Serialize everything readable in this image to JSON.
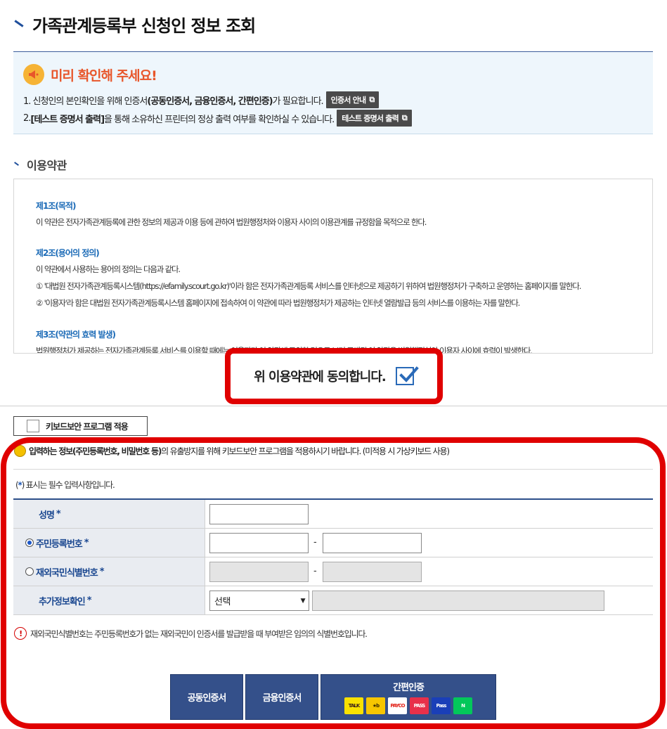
{
  "page": {
    "title": "가족관계등록부 신청인 정보 조회"
  },
  "notice": {
    "heading": "미리 확인해 주세요!",
    "line1_prefix": "1. 신청인의 본인확인을 위해 인증서",
    "line1_bold": "(공동인증서, 금융인증서, 간편인증)",
    "line1_suffix": "가 필요합니다.",
    "line1_button": "인증서 안내",
    "line2_prefix": "2. ",
    "line2_bold": "[테스트 증명서 출력]",
    "line2_suffix": "을 통해 소유하신 프린터의 정상 출력 여부를 확인하실 수 있습니다.",
    "line2_button": "테스트 증명서 출력"
  },
  "terms": {
    "section_title": "이용약관",
    "art1_title": "제1조(목적)",
    "art1_text": "이 약관은 전자가족관계등록에 관한 정보의 제공과 이용 등에 관하여 법원행정처와 이용자 사이의 이용관계를 규정함을 목적으로 한다.",
    "art2_title": "제2조(용어의 정의)",
    "art2_text1": "이 약관에서 사용하는 용어의 정의는 다음과 같다.",
    "art2_text2": "① '대법원 전자가족관계등록시스템(https://efamily.scourt.go.kr)'이라 함은 전자가족관계등록 서비스를 인터넷으로 제공하기 위하여 법원행정처가 구축하고 운영하는 홈페이지를 말한다.",
    "art2_text3": "② '이용자'라 함은 대법원 전자가족관계등록시스템 홈페이지에 접속하여 이 약관에 따라 법원행정처가 제공하는 인터넷 열람발급 등의 서비스를 이용하는 자를 말한다.",
    "art3_title": "제3조(약관의 효력 발생)",
    "art3_text": "법원행정처가 제공하는 전자가족관계등록 서비스를 이용할 때에는 이용자가 이 약관에 동의한 것으로 보며 공개된 이 약관은 법원행정처와 이용자 사이에 효력이 발생한다."
  },
  "agree": {
    "label": "위 이용약관에 동의합니다.",
    "checked": true
  },
  "keyboard": {
    "button_label": "키보드보안 프로그램 적용",
    "note_bold": "입력하는 정보(주민등록번호, 비밀번호 등)",
    "note_rest": "의 유출방지를 위해 키보드보안 프로그램을 적용하시기 바랍니다. (미적용 시 가상키보드 사용)"
  },
  "required_note": {
    "open": "(",
    "star": "*",
    "rest": ") 표시는 필수 입력사항입니다."
  },
  "form": {
    "name_label": "성명",
    "rrn_label": "주민등록번호",
    "foreign_label": "재외국민식별번호",
    "extra_label": "추가정보확인",
    "star": "*",
    "dash": "-",
    "select_value": "선택",
    "rrn_selected": true
  },
  "foreign_note": "재외국민식별번호는 주민등록번호가 없는 재외국민이 인증서를 발급받을 때 부여받은 임의의 식별번호입니다.",
  "auth": {
    "joint_cert": "공동인증서",
    "financial_cert": "금융인증서",
    "simple_auth": "간편인증",
    "providers": [
      {
        "icon": "kakao-talk-icon",
        "text": "TALK",
        "bg": "#fae100",
        "fg": "#3a1d1d"
      },
      {
        "icon": "kb-icon",
        "text": "★b",
        "bg": "#f7c600",
        "fg": "#3a2a00"
      },
      {
        "icon": "payco-icon",
        "text": "PAYCO",
        "bg": "#ffffff",
        "fg": "#e2231a"
      },
      {
        "icon": "pass-icon",
        "text": "PASS",
        "bg": "#e8304a",
        "fg": "#ffffff"
      },
      {
        "icon": "samsung-pass-icon",
        "text": "Pass",
        "bg": "#1a3fb8",
        "fg": "#ffffff"
      },
      {
        "icon": "naver-icon",
        "text": "N",
        "bg": "#03c75a",
        "fg": "#ffffff"
      }
    ]
  }
}
